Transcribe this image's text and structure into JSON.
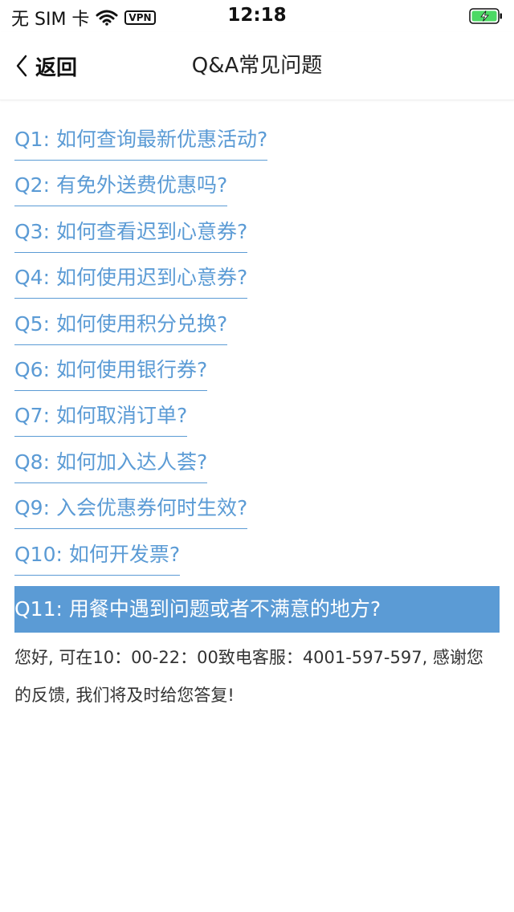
{
  "status_bar": {
    "carrier": "无 SIM 卡",
    "wifi_icon": "wifi-icon",
    "vpn": "VPN",
    "time": "12:18",
    "battery_icon": "battery-charging-icon",
    "battery_color": "#4cd964"
  },
  "nav": {
    "back_label": "返回",
    "title": "Q&A常见问题"
  },
  "faq": {
    "items": [
      "Q1: 如何查询最新优惠活动?",
      "Q2: 有免外送费优惠吗?",
      "Q3: 如何查看迟到心意券?",
      "Q4: 如何使用迟到心意券?",
      "Q5: 如何使用积分兑换?",
      "Q6: 如何使用银行券?",
      "Q7: 如何取消订单?",
      "Q8: 如何加入达人荟?",
      "Q9: 入会优惠券何时生效?",
      "Q10: 如何开发票?"
    ],
    "active_question": "Q11: 用餐中遇到问题或者不满意的地方?",
    "answer": "您好, 可在10：00-22：00致电客服：4001-597-597, 感谢您的反馈, 我们将及时给您答复!"
  },
  "colors": {
    "accent": "#5b9bd5",
    "text": "#333333"
  }
}
